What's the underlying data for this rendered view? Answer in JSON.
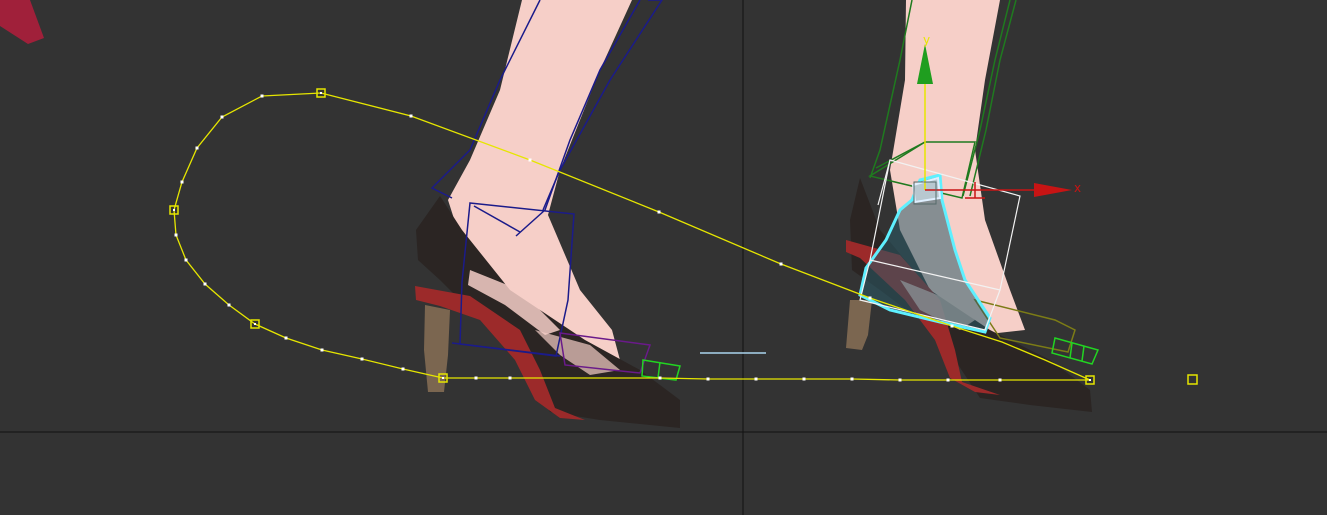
{
  "viewport": {
    "background": "#333333",
    "crosshair_color": "#111111"
  },
  "gizmo": {
    "y_label": "y",
    "x_label": "x",
    "y_color": "#1f9e1f",
    "x_color": "#c81414",
    "center_color": "#e6e600"
  },
  "motion_path": {
    "color": "#e6e600",
    "keyframe_marker": "square"
  },
  "colors": {
    "skin": "#f6cfc8",
    "shoe_dark": "#2b2523",
    "shoe_red": "#9c2a2a",
    "heel": "#7b6650",
    "selected_highlight": "#5ef0ff",
    "bone_blue": "#1b1b8a",
    "bone_green": "#1f7a1f",
    "bone_purple": "#6a1a8a",
    "bone_lime": "#22d422",
    "bone_olive": "#7c7c16"
  }
}
